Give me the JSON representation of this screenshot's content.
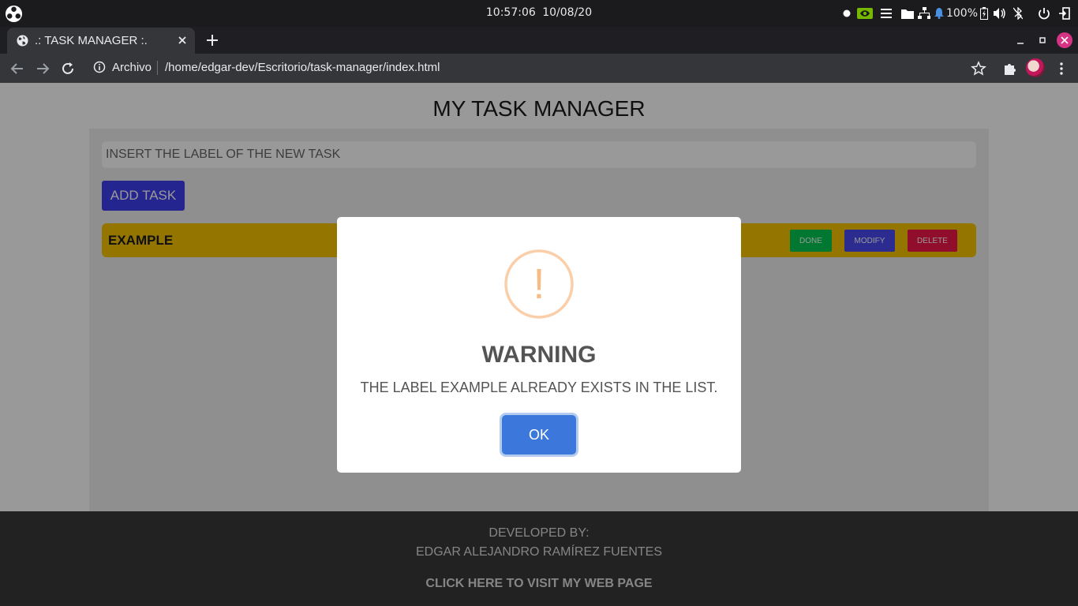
{
  "os": {
    "time": "10:57:06",
    "date": "10/08/20",
    "battery": "100%",
    "tray_icons": [
      "record-dot-icon",
      "nvidia-icon",
      "menu-icon",
      "folder-icon",
      "network-icon",
      "bell-icon",
      "battery-icon",
      "volume-icon",
      "bluetooth-off-icon",
      "power-icon",
      "exit-icon"
    ]
  },
  "browser": {
    "tab_title": ".: TASK MANAGER :.",
    "address_scheme": "Archivo",
    "address_url": "/home/edgar-dev/Escritorio/task-manager/index.html"
  },
  "page": {
    "title": "MY TASK MANAGER",
    "input_placeholder": "INSERT THE LABEL OF THE NEW TASK",
    "add_button": "ADD TASK",
    "tasks": [
      {
        "label": "EXAMPLE",
        "done": "DONE",
        "modify": "MODIFY",
        "delete": "DELETE"
      }
    ],
    "footer": {
      "developed_by": "DEVELOPED BY:",
      "author": "EDGAR ALEJANDRO RAMÍREZ FUENTES",
      "link": "CLICK HERE TO VISIT MY WEB PAGE"
    }
  },
  "dialog": {
    "icon": "!",
    "title": "WARNING",
    "text": "THE LABEL EXAMPLE ALREADY EXISTS IN THE LIST.",
    "ok": "OK"
  },
  "colors": {
    "task_bg": "#f5c400",
    "add_btn": "#3f3ff0",
    "done_btn": "#00c853",
    "modify_btn": "#4a4af0",
    "delete_btn": "#f0184a",
    "warning_icon": "#f8bb86",
    "ok_btn": "#3c78dc"
  }
}
